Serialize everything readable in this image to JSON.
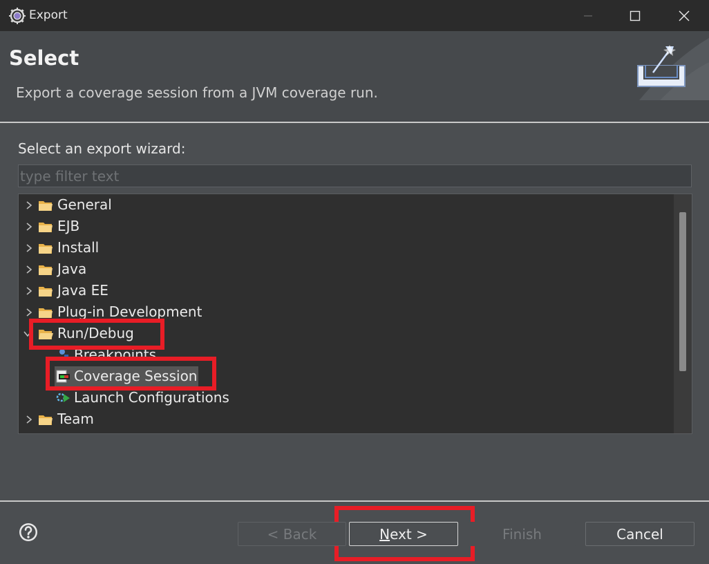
{
  "window": {
    "title": "Export"
  },
  "header": {
    "title": "Select",
    "description": "Export a coverage session from a JVM coverage run."
  },
  "wizard": {
    "label": "Select an export wizard:",
    "filter_placeholder": "type filter text"
  },
  "tree": {
    "items": [
      {
        "label": "General",
        "expanded": false
      },
      {
        "label": "EJB",
        "expanded": false
      },
      {
        "label": "Install",
        "expanded": false
      },
      {
        "label": "Java",
        "expanded": false
      },
      {
        "label": "Java EE",
        "expanded": false
      },
      {
        "label": "Plug-in Development",
        "expanded": false
      },
      {
        "label": "Run/Debug",
        "expanded": true
      },
      {
        "label": "Breakpoints",
        "child": true
      },
      {
        "label": "Coverage Session",
        "child": true,
        "selected": true
      },
      {
        "label": "Launch Configurations",
        "child": true
      },
      {
        "label": "Team",
        "expanded": false
      }
    ]
  },
  "buttons": {
    "back": "< Back",
    "next_mnemonic": "N",
    "next_rest": "ext >",
    "finish": "Finish",
    "cancel": "Cancel"
  },
  "colors": {
    "highlight": "#e81d26",
    "titlebar": "#2b2b2b",
    "tree_bg": "#2f2f2f",
    "folder": "#f0c060"
  },
  "icons": {
    "help": "help-icon",
    "folder": "folder-icon",
    "minimize": "minimize-icon",
    "maximize": "maximize-icon",
    "close": "close-icon"
  }
}
